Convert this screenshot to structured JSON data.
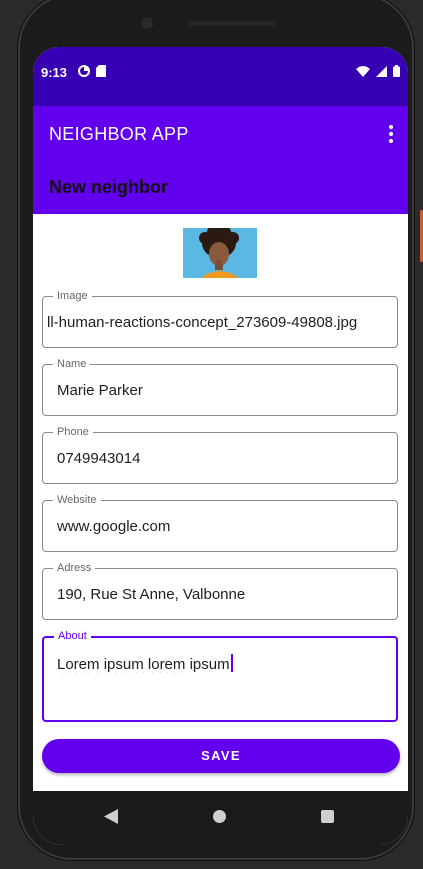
{
  "status_bar": {
    "time": "9:13",
    "left_icons": [
      "data-saver-icon",
      "sd-card-icon"
    ],
    "right_icons": [
      "wifi-icon",
      "signal-icon",
      "battery-icon"
    ]
  },
  "app_bar": {
    "title": "NEIGHBOR APP",
    "menu_icon": "more-vert-icon"
  },
  "page": {
    "subtitle": "New neighbor"
  },
  "form": {
    "image": {
      "label": "Image",
      "value": "ll-human-reactions-concept_273609-49808.jpg"
    },
    "name": {
      "label": "Name",
      "value": "Marie Parker"
    },
    "phone": {
      "label": "Phone",
      "value": "0749943014"
    },
    "website": {
      "label": "Website",
      "value": "www.google.com"
    },
    "address": {
      "label": "Adress",
      "value": "190, Rue St Anne, Valbonne"
    },
    "about": {
      "label": "About",
      "words": [
        "Lorem",
        "ipsum",
        "lorem",
        "ipsum"
      ]
    },
    "save_label": "SAVE"
  },
  "colors": {
    "primary": "#6200ee",
    "primary_dark": "#3700b3"
  },
  "nav_bar": {
    "icons": [
      "back-icon",
      "home-icon",
      "recents-icon"
    ]
  }
}
